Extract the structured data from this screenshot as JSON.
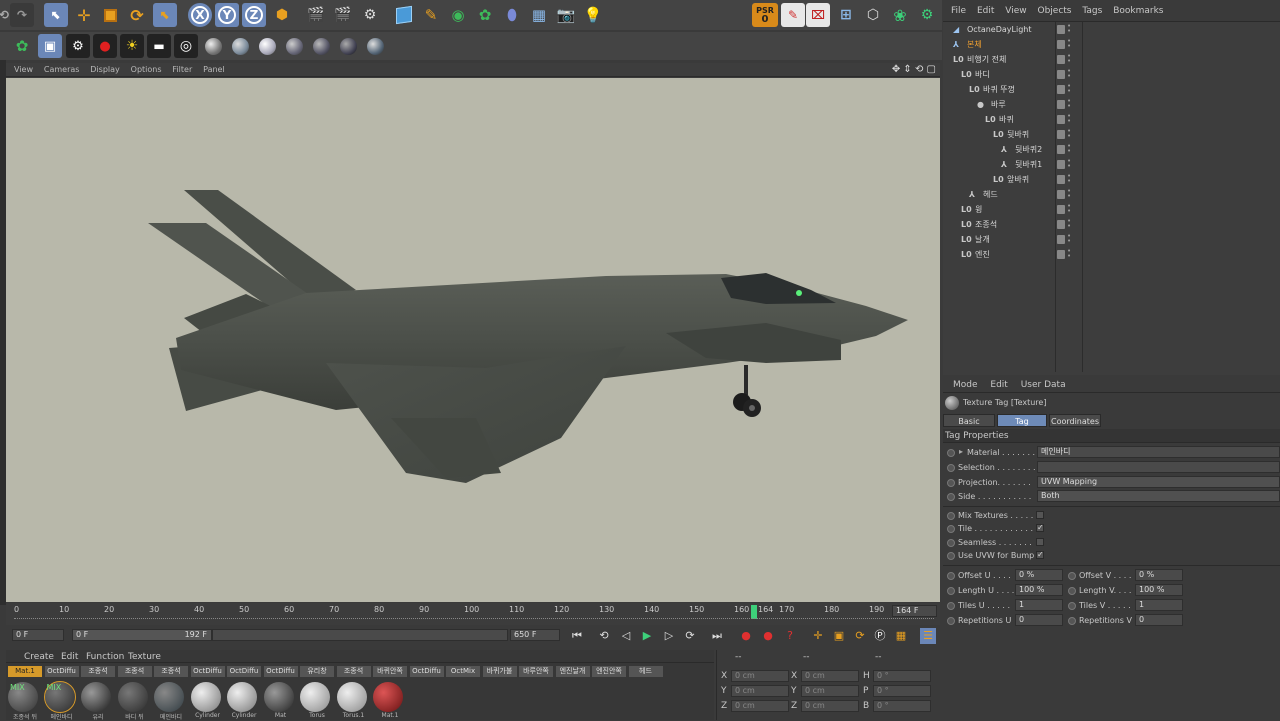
{
  "toolbar": {
    "psr_label": "PSR",
    "psr_value": "0",
    "axis_x": "X",
    "axis_y": "Y",
    "axis_z": "Z"
  },
  "viewport": {
    "menu": [
      "View",
      "Cameras",
      "Display",
      "Options",
      "Filter",
      "Panel"
    ]
  },
  "object_manager": {
    "menu": [
      "File",
      "Edit",
      "View",
      "Objects",
      "Tags",
      "Bookmarks"
    ],
    "items": [
      {
        "label": "OctaneDayLight"
      },
      {
        "label": "본체"
      },
      {
        "label": "비행기 전체"
      },
      {
        "label": "바디"
      },
      {
        "label": "바퀴 뚜껑"
      },
      {
        "label": "바루"
      },
      {
        "label": "바퀴"
      },
      {
        "label": "뒷바퀴"
      },
      {
        "label": "뒷바퀴2"
      },
      {
        "label": "뒷바퀴1"
      },
      {
        "label": "앞바퀴"
      },
      {
        "label": "헤드"
      },
      {
        "label": "윙"
      },
      {
        "label": "조종석"
      },
      {
        "label": "날개"
      },
      {
        "label": "엔진"
      }
    ]
  },
  "attributes": {
    "menu": [
      "Mode",
      "Edit",
      "User Data"
    ],
    "title": "Texture Tag [Texture]",
    "tabs": [
      "Basic",
      "Tag",
      "Coordinates"
    ],
    "section": "Tag Properties",
    "material_label": "Material . . . . . . .",
    "material_value": "메인바디",
    "selection_label": "Selection . . . . . . . .",
    "projection_label": "Projection. . . . . . .",
    "projection_value": "UVW Mapping",
    "side_label": "Side . . . . . . . . . . .",
    "side_value": "Both",
    "mix_label": "Mix Textures . . . . .",
    "tile_label": "Tile . . . . . . . . . . . .",
    "seamless_label": "Seamless . . . . . . .",
    "uvw_bump_label": "Use UVW for Bump",
    "offset_u_label": "Offset U . . . .",
    "offset_u": "0 %",
    "offset_v_label": "Offset V . . . .",
    "offset_v": "0 %",
    "length_u_label": "Length U . . . .",
    "length_u": "100 %",
    "length_v_label": "Length V. . . .",
    "length_v": "100 %",
    "tiles_u_label": "Tiles U . . . . .",
    "tiles_u": "1",
    "tiles_v_label": "Tiles V . . . . .",
    "tiles_v": "1",
    "rep_u_label": "Repetitions U",
    "rep_u": "0",
    "rep_v_label": "Repetitions V",
    "rep_v": "0"
  },
  "timeline": {
    "ticks": [
      "0",
      "10",
      "20",
      "30",
      "40",
      "50",
      "60",
      "70",
      "80",
      "90",
      "100",
      "110",
      "120",
      "130",
      "140",
      "150",
      "160",
      "170",
      "180",
      "190"
    ],
    "current_frame": "164",
    "current_display": "164 F",
    "start": "0 F",
    "range_start": "0 F",
    "range_end": "192 F",
    "end": "650 F"
  },
  "material_manager": {
    "menu": [
      "Create",
      "Edit",
      "Function",
      "Texture"
    ],
    "labels": [
      "Mat.1",
      "OctDiffu",
      "조종석",
      "조종석",
      "조종석",
      "OctDiffu",
      "OctDiffu",
      "OctDiffu",
      "유리창",
      "조종석",
      "바퀴안쪽",
      "OctDiffu",
      "OctMix",
      "바퀴가불",
      "바루안쪽",
      "엔진날개",
      "엔진안쪽",
      "헤드"
    ],
    "thumbs": [
      {
        "name": "MIX",
        "sub": "조종석 뒤"
      },
      {
        "name": "MIX",
        "sub": "메인바디"
      },
      {
        "name": "",
        "sub": "유리"
      },
      {
        "name": "",
        "sub": "바디 뒤"
      },
      {
        "name": "",
        "sub": "메인바디"
      },
      {
        "name": "",
        "sub": "Cylinder"
      },
      {
        "name": "",
        "sub": "Cylinder"
      },
      {
        "name": "",
        "sub": "Mat"
      },
      {
        "name": "",
        "sub": "Torus"
      },
      {
        "name": "",
        "sub": "Torus.1"
      },
      {
        "name": "",
        "sub": "Mat.1"
      }
    ]
  },
  "coordinates": {
    "header_left": "--",
    "header_mid": "--",
    "header_right": "--",
    "rows": [
      {
        "a": "X",
        "av": "0 cm",
        "b": "X",
        "bv": "0 cm",
        "c": "H",
        "cv": "0 °"
      },
      {
        "a": "Y",
        "av": "0 cm",
        "b": "Y",
        "bv": "0 cm",
        "c": "P",
        "cv": "0 °"
      },
      {
        "a": "Z",
        "av": "0 cm",
        "b": "Z",
        "bv": "0 cm",
        "c": "B",
        "cv": "0 °"
      }
    ]
  },
  "colors": {
    "accent": "#6e8bb8",
    "selected_material": "#d69a2a",
    "viewport_bg": "#b8b8aa",
    "jet": "#4e524c"
  }
}
